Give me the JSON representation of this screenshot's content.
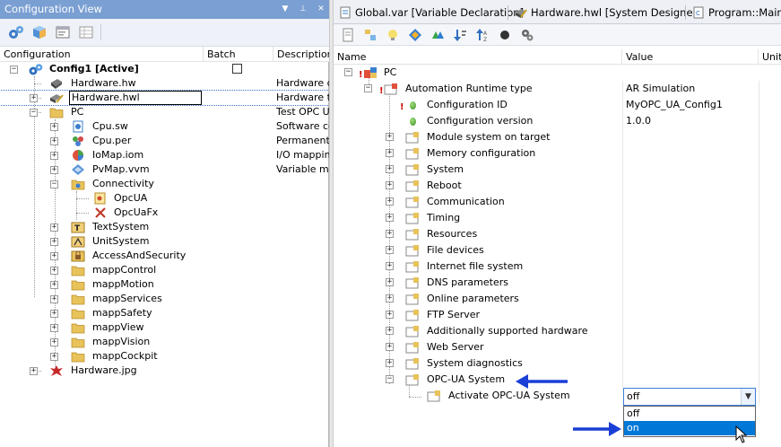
{
  "config_view": {
    "title": "Configuration View",
    "controls": [
      "▼",
      "⊥",
      "✕"
    ],
    "columns": {
      "configuration": "Configuration",
      "batch": "Batch",
      "description": "Description"
    },
    "tree": [
      {
        "label": "Config1 [Active]",
        "desc": "",
        "icon": "config-icon",
        "bold": true
      },
      {
        "label": "Hardware.hw",
        "desc": "Hardware c",
        "icon": "hardware-icon"
      },
      {
        "label": "Hardware.hwl",
        "desc": "Hardware to",
        "icon": "hardware-list-icon"
      },
      {
        "label": "PC",
        "desc": "Test OPC U",
        "icon": "folder-icon"
      },
      {
        "label": "Cpu.sw",
        "desc": "Software co",
        "icon": "software-config-icon"
      },
      {
        "label": "Cpu.per",
        "desc": "Permanent v",
        "icon": "permanent-vars-icon"
      },
      {
        "label": "IoMap.iom",
        "desc": "I/O mapping",
        "icon": "iomap-icon"
      },
      {
        "label": "PvMap.vvm",
        "desc": "Variable ma",
        "icon": "pvmap-icon"
      },
      {
        "label": "Connectivity",
        "desc": "",
        "icon": "connectivity-folder-icon"
      },
      {
        "label": "OpcUA",
        "desc": "",
        "icon": "opcua-icon"
      },
      {
        "label": "OpcUaFx",
        "desc": "",
        "icon": "opcuafx-icon"
      },
      {
        "label": "TextSystem",
        "desc": "",
        "icon": "textsystem-icon"
      },
      {
        "label": "UnitSystem",
        "desc": "",
        "icon": "unitsystem-icon"
      },
      {
        "label": "AccessAndSecurity",
        "desc": "",
        "icon": "security-icon"
      },
      {
        "label": "mappControl",
        "desc": "",
        "icon": "folder-icon"
      },
      {
        "label": "mappMotion",
        "desc": "",
        "icon": "folder-icon"
      },
      {
        "label": "mappServices",
        "desc": "",
        "icon": "folder-icon"
      },
      {
        "label": "mappSafety",
        "desc": "",
        "icon": "folder-icon"
      },
      {
        "label": "mappView",
        "desc": "",
        "icon": "folder-icon"
      },
      {
        "label": "mappVision",
        "desc": "",
        "icon": "folder-icon"
      },
      {
        "label": "mappCockpit",
        "desc": "",
        "icon": "folder-icon"
      },
      {
        "label": "Hardware.jpg",
        "desc": "",
        "icon": "image-icon"
      }
    ]
  },
  "tabs": [
    {
      "label": "Global.var [Variable Declaration]",
      "icon": "variable-file-icon"
    },
    {
      "label": "Hardware.hwl [System Designer]",
      "icon": "hardware-list-icon"
    },
    {
      "label": "Program::Main.c",
      "icon": "program-file-icon"
    }
  ],
  "property_grid": {
    "columns": {
      "name": "Name",
      "value": "Value",
      "unit": "Unit"
    },
    "rows": [
      {
        "name": "PC",
        "value": ""
      },
      {
        "name": "Automation Runtime type",
        "value": "AR Simulation"
      },
      {
        "name": "Configuration ID",
        "value": "MyOPC_UA_Config1"
      },
      {
        "name": "Configuration version",
        "value": "1.0.0"
      },
      {
        "name": "Module system on target",
        "value": ""
      },
      {
        "name": "Memory configuration",
        "value": ""
      },
      {
        "name": "System",
        "value": ""
      },
      {
        "name": "Reboot",
        "value": ""
      },
      {
        "name": "Communication",
        "value": ""
      },
      {
        "name": "Timing",
        "value": ""
      },
      {
        "name": "Resources",
        "value": ""
      },
      {
        "name": "File devices",
        "value": ""
      },
      {
        "name": "Internet file system",
        "value": ""
      },
      {
        "name": "DNS parameters",
        "value": ""
      },
      {
        "name": "Online parameters",
        "value": ""
      },
      {
        "name": "FTP Server",
        "value": ""
      },
      {
        "name": "Additionally supported hardware",
        "value": ""
      },
      {
        "name": "Web Server",
        "value": ""
      },
      {
        "name": "System diagnostics",
        "value": ""
      },
      {
        "name": "OPC-UA System",
        "value": ""
      },
      {
        "name": "Activate OPC-UA System",
        "value": ""
      }
    ]
  },
  "combo": {
    "selected": "off",
    "options": [
      "off",
      "on"
    ],
    "highlighted": "on"
  },
  "colors": {
    "title_bar": "#7a9fd2",
    "selection": "#0078d7",
    "arrow": "#1a3fd6"
  }
}
